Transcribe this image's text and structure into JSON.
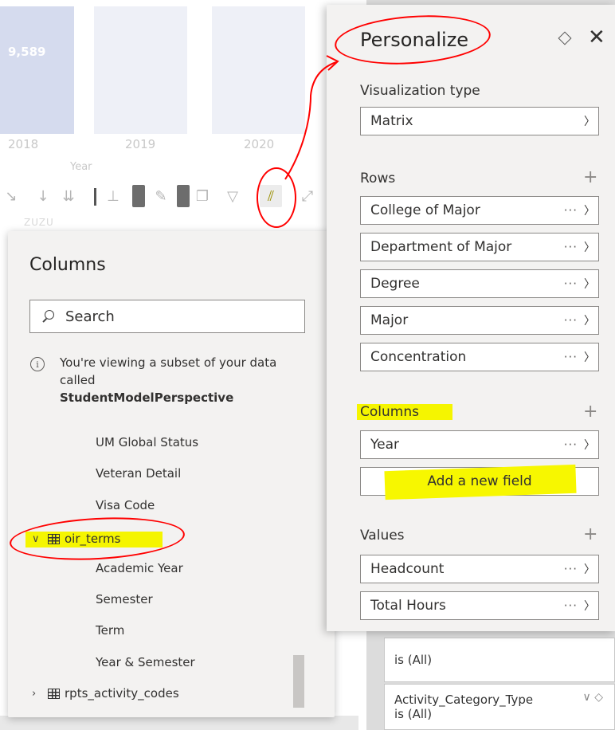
{
  "background": {
    "bar_value": "9,589",
    "years": [
      "2018",
      "2019",
      "2020"
    ],
    "axis_title": "Year",
    "right_cards": [
      {
        "text": "is (All)"
      },
      {
        "title": "Activity_Category_Type",
        "text": "is (All)"
      }
    ]
  },
  "toolbar": {
    "icons": [
      "sort-icon",
      "drill-down-icon",
      "expand-all-icon",
      "hierarchy-icon",
      "pin-icon",
      "copy-icon",
      "filter-icon",
      "personalize-visual-icon",
      "focus-mode-icon"
    ]
  },
  "columns_panel": {
    "title": "Columns",
    "search_placeholder": "Search",
    "info_text": "You're viewing a subset of your data called",
    "info_strong": "StudentModelPerspective",
    "fields_before": [
      "UM Global Status",
      "Veteran Detail",
      "Visa Code"
    ],
    "expanded_table": "oir_terms",
    "table_fields": [
      "Academic Year",
      "Semester",
      "Term",
      "Year & Semester"
    ],
    "collapsed_table": "rpts_activity_codes"
  },
  "personalize": {
    "title": "Personalize",
    "viz_label": "Visualization type",
    "viz_value": "Matrix",
    "rows_label": "Rows",
    "rows": [
      "College of Major",
      "Department of Major",
      "Degree",
      "Major",
      "Concentration"
    ],
    "columns_label": "Columns",
    "columns": [
      "Year"
    ],
    "add_field": "Add a new field",
    "values_label": "Values",
    "values": [
      "Headcount",
      "Total Hours"
    ],
    "more": "···"
  },
  "colors": {
    "highlight": "#f5f500",
    "annotation": "#ff0000",
    "pane_bg": "#f3f2f1"
  }
}
